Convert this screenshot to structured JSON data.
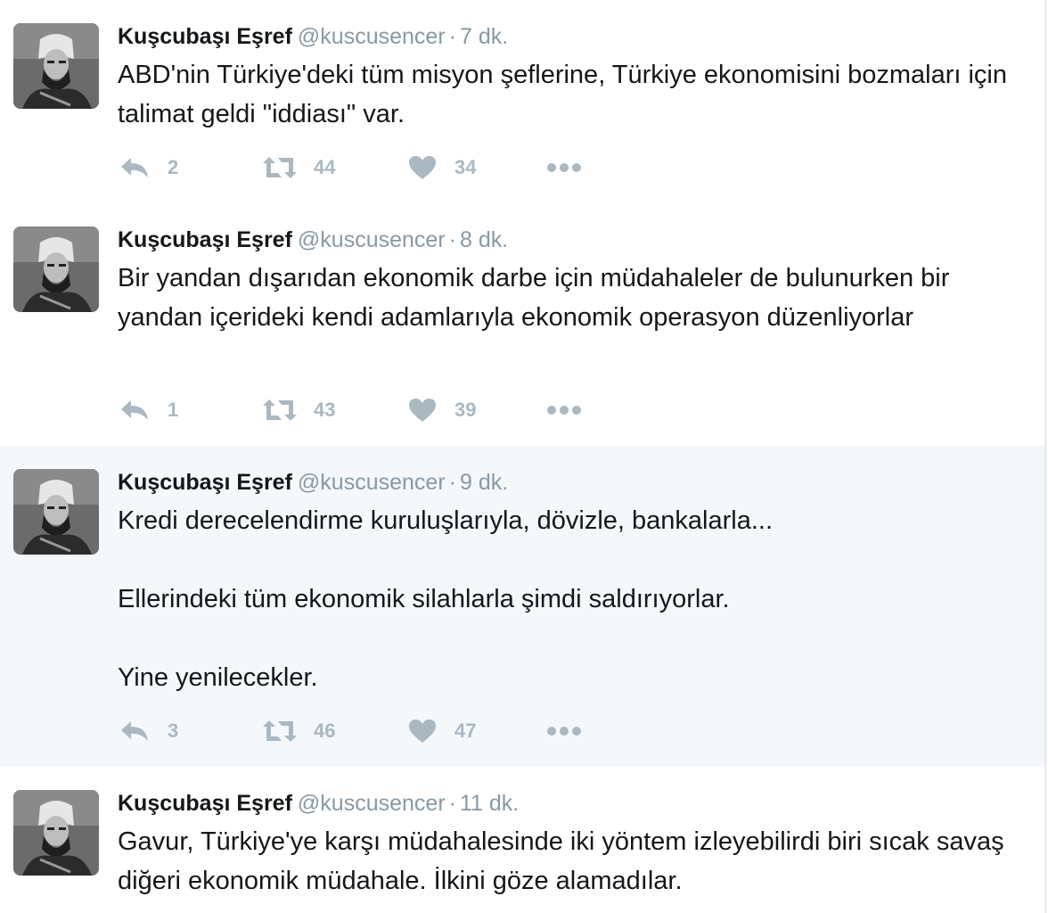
{
  "colors": {
    "name": "#14171a",
    "meta": "#8899a6",
    "action": "#aab8c2",
    "highlight_bg": "#f5f8fa",
    "divider": "#e6ecf0"
  },
  "tweets": [
    {
      "name": "Kuşcubaşı Eşref",
      "handle": "@kuscusencer",
      "separator": "·",
      "time": "7 dk.",
      "paragraphs": [
        "ABD'nin Türkiye'deki tüm misyon şeflerine, Türkiye ekonomisini bozmaları için talimat geldi \"iddiası\" var."
      ],
      "reply_count": "2",
      "retweet_count": "44",
      "like_count": "34"
    },
    {
      "name": "Kuşcubaşı Eşref",
      "handle": "@kuscusencer",
      "separator": "·",
      "time": "8 dk.",
      "paragraphs": [
        "Bir yandan dışarıdan ekonomik darbe için müdahaleler de bulunurken bir yandan içerideki kendi adamlarıyla ekonomik operasyon düzenliyorlar"
      ],
      "reply_count": "1",
      "retweet_count": "43",
      "like_count": "39"
    },
    {
      "name": "Kuşcubaşı Eşref",
      "handle": "@kuscusencer",
      "separator": "·",
      "time": "9 dk.",
      "paragraphs": [
        "Kredi derecelendirme kuruluşlarıyla, dövizle, bankalarla...",
        "Ellerindeki tüm ekonomik silahlarla şimdi saldırıyorlar.",
        "Yine yenilecekler."
      ],
      "reply_count": "3",
      "retweet_count": "46",
      "like_count": "47"
    },
    {
      "name": "Kuşcubaşı Eşref",
      "handle": "@kuscusencer",
      "separator": "·",
      "time": "11 dk.",
      "paragraphs": [
        "Gavur, Türkiye'ye karşı müdahalesinde iki yöntem izleyebilirdi biri sıcak savaş diğeri ekonomik müdahale. İlkini göze alamadılar."
      ],
      "reply_count": "",
      "retweet_count": "",
      "like_count": ""
    }
  ]
}
